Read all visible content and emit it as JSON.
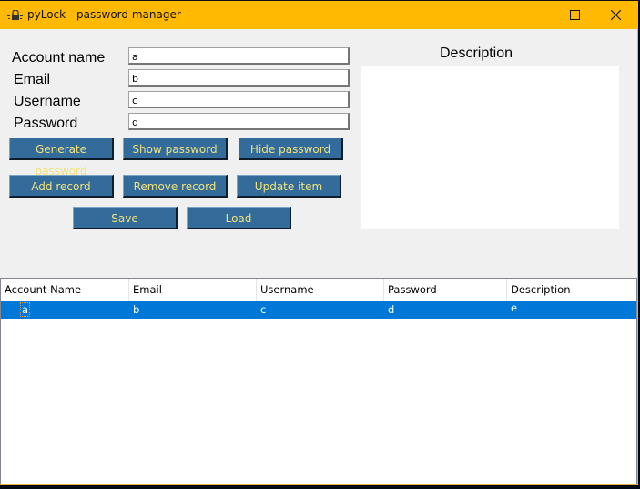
{
  "window": {
    "title": "pyLock - password manager",
    "icon": "lock-icon",
    "titlebar_color": "#ffb900",
    "controls": {
      "minimize": "minimize-icon",
      "maximize": "maximize-icon",
      "close": "close-icon"
    }
  },
  "form": {
    "fields": [
      {
        "label": "Account name",
        "value": "a"
      },
      {
        "label": "Email",
        "value": "b"
      },
      {
        "label": "Username",
        "value": "c"
      },
      {
        "label": "Password",
        "value": "d"
      }
    ],
    "description_label": "Description",
    "description_value": ""
  },
  "buttons": {
    "generate_password": "Generate password",
    "show_password": "Show password",
    "hide_password": "Hide password",
    "add_record": "Add record",
    "remove_record": "Remove record",
    "update_item": "Update item",
    "save": "Save",
    "load": "Load",
    "button_color": "#336b9b",
    "button_text_color": "#f2e27a"
  },
  "table": {
    "columns": [
      "Account Name",
      "Email",
      "Username",
      "Password",
      "Description"
    ],
    "rows": [
      {
        "cells": [
          "a",
          "b",
          "c",
          "d",
          "e"
        ],
        "selected": true
      }
    ],
    "selection_color": "#0078d7"
  }
}
